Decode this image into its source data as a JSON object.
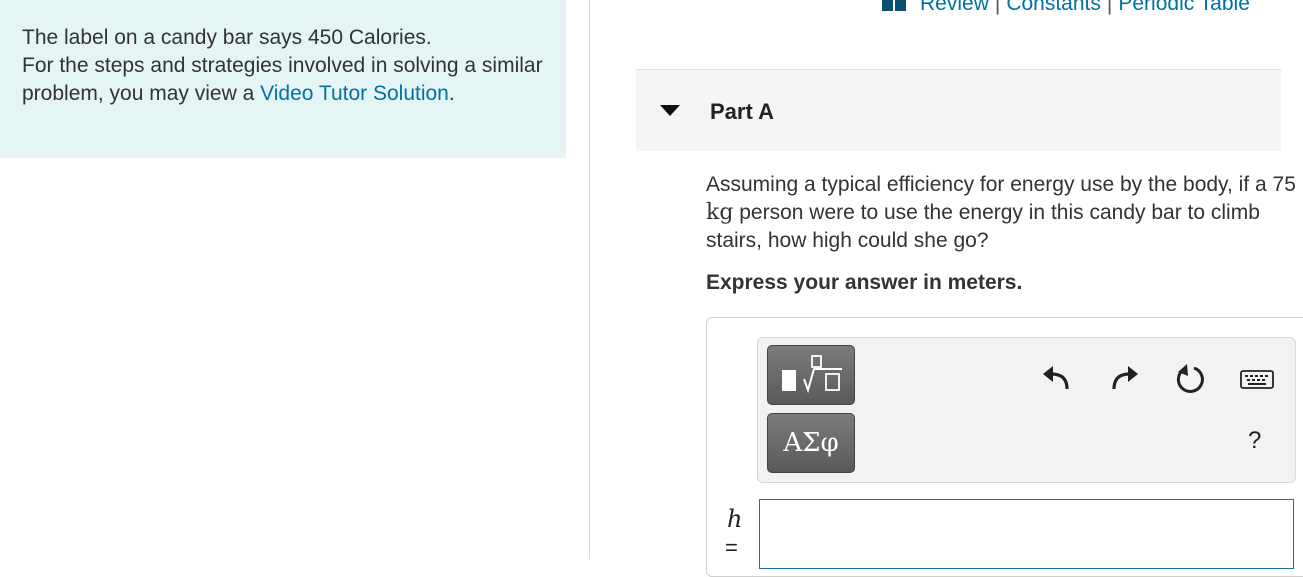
{
  "intro": {
    "line1": "The label on a candy bar says 450 Calories.",
    "line2_before_link": "For the steps and strategies involved in solving a similar problem, you may view a ",
    "link_text": "Video Tutor Solution",
    "line2_after_link": "."
  },
  "toplinks": {
    "review": "Review",
    "constants": "Constants",
    "periodic_table": "Periodic Table",
    "separator": "|"
  },
  "part": {
    "title": "Part A",
    "question_before_unit": "Assuming a typical efficiency for energy use by the body, if a 75 ",
    "question_unit": "kg",
    "question_after_unit": " person were to use the energy in this candy bar to climb stairs, how high could she go?",
    "instruction": "Express your answer in meters."
  },
  "toolbar": {
    "greek_label": "ΑΣφ",
    "help_label": "?"
  },
  "answer": {
    "variable": "h",
    "equals": "=",
    "value": ""
  },
  "colors": {
    "link": "#0071a3",
    "intro_bg": "#e5f4f5",
    "button_dark": "#6a6a6a"
  }
}
